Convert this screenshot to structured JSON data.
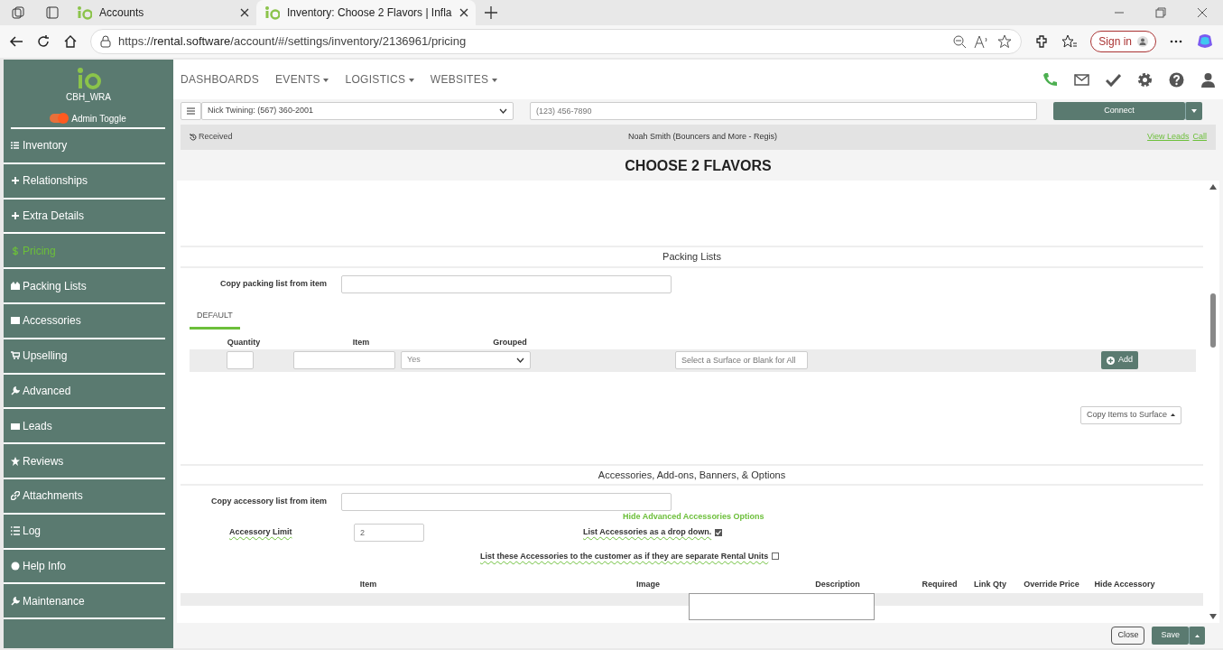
{
  "browser": {
    "tabs": [
      {
        "title": "Accounts",
        "selected": false
      },
      {
        "title": "Inventory: Choose 2 Flavors | Infla",
        "selected": true
      }
    ],
    "url_prefix": "https://",
    "url_host": "rental.software",
    "url_path": "/account/#/settings/inventory/2136961/pricing",
    "sign_in": "Sign in"
  },
  "sidebar": {
    "brand": "CBH_WRA",
    "admin_toggle": {
      "label": "Admin Toggle",
      "on": true
    },
    "items": [
      {
        "label": "Inventory",
        "selected": false
      },
      {
        "label": "Relationships",
        "selected": false
      },
      {
        "label": "Extra Details",
        "selected": false
      },
      {
        "label": "Pricing",
        "selected": true
      },
      {
        "label": "Packing Lists",
        "selected": false
      },
      {
        "label": "Accessories",
        "selected": false
      },
      {
        "label": "Upselling",
        "selected": false
      },
      {
        "label": "Advanced",
        "selected": false
      },
      {
        "label": "Leads",
        "selected": false
      },
      {
        "label": "Reviews",
        "selected": false
      },
      {
        "label": "Attachments",
        "selected": false
      },
      {
        "label": "Log",
        "selected": false
      },
      {
        "label": "Help Info",
        "selected": false
      },
      {
        "label": "Maintenance",
        "selected": false
      }
    ]
  },
  "topnav": {
    "items": [
      {
        "label": "DASHBOARDS",
        "dropdown": false
      },
      {
        "label": "EVENTS",
        "dropdown": true
      },
      {
        "label": "LOGISTICS",
        "dropdown": true
      },
      {
        "label": "WEBSITES",
        "dropdown": true
      }
    ]
  },
  "callbar": {
    "contact": "Nick Twining: (567) 360-2001",
    "phone_placeholder": "(123) 456-7890",
    "connect": "Connect"
  },
  "lead_bar": {
    "status": "Received",
    "name": "Noah Smith (Bouncers and More - Regis)",
    "links": [
      "View Leads",
      "Call"
    ]
  },
  "page_title": "CHOOSE 2 FLAVORS",
  "packing": {
    "heading": "Packing Lists",
    "copy_label": "Copy packing list from item",
    "tabs": [
      {
        "label": "DEFAULT",
        "selected": true
      }
    ],
    "columns": [
      "Quantity",
      "Item",
      "Grouped"
    ],
    "grouped_value": "Yes",
    "surface_placeholder": "Select a Surface or Blank for All",
    "add": "Add",
    "copy_items": "Copy Items to Surface"
  },
  "accessories": {
    "heading": "Accessories, Add-ons, Banners, & Options",
    "copy_label": "Copy accessory list from item",
    "hide_link": "Hide Advanced Accessories Options",
    "limit_label": "Accessory Limit",
    "limit_value": "2",
    "options": [
      {
        "label": "List Accessories as a drop down.",
        "checked": true
      },
      {
        "label": "List these Accessories to the customer as if they are separate Rental Units",
        "checked": false
      }
    ],
    "columns": [
      "Item",
      "Image",
      "Description",
      "Required",
      "Link Qty",
      "Override Price",
      "Hide Accessory"
    ]
  },
  "footer": {
    "close": "Close",
    "save": "Save"
  }
}
